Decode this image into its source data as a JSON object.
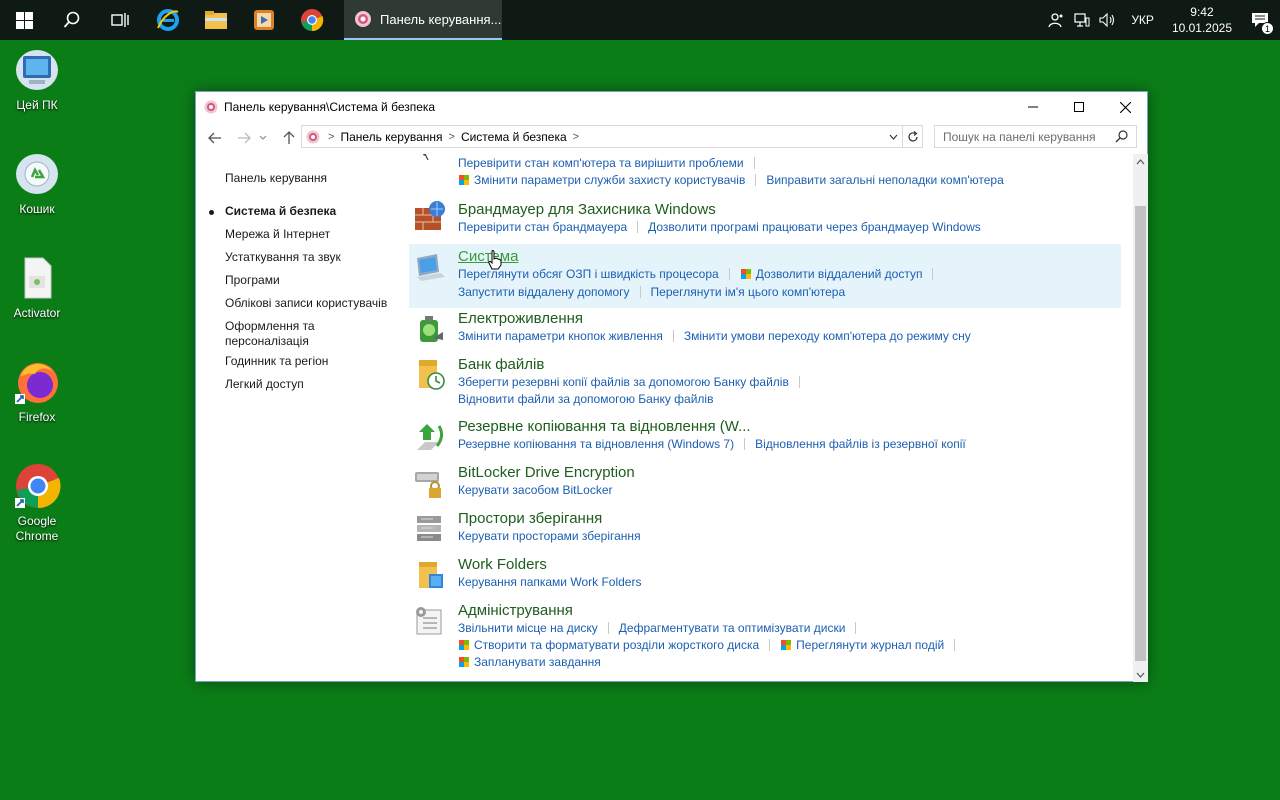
{
  "taskbar": {
    "active_task": "Панель керування...",
    "tray_lang": "УКР",
    "clock_time": "9:42",
    "clock_date": "10.01.2025",
    "notifications_count": "1"
  },
  "desktop": {
    "icons": [
      {
        "label": "Цей ПК"
      },
      {
        "label": "Кошик"
      },
      {
        "label": "Activator"
      },
      {
        "label": "Firefox"
      },
      {
        "label": "Google Chrome"
      }
    ]
  },
  "window": {
    "title": "Панель керування\\Система й безпека",
    "breadcrumb": [
      "Панель керування",
      "Система й безпека"
    ],
    "search_placeholder": "Пошук на панелі керування"
  },
  "leftnav": {
    "home": "Панель керування",
    "items": [
      "Система й безпека",
      "Мережа й Інтернет",
      "Устаткування та звук",
      "Програми",
      "Облікові записи користувачів",
      "Оформлення та",
      "персоналізація",
      "Годинник та регіон",
      "Легкий доступ"
    ]
  },
  "categories": {
    "security": {
      "links_row1": [
        "Перевірити стан комп'ютера та вирішити проблеми"
      ],
      "links_row2": [
        "Змінити параметри служби захисту користувачів",
        "Виправити загальні неполадки комп'ютера"
      ]
    },
    "firewall": {
      "title": "Брандмауер для Захисника Windows",
      "links": [
        "Перевірити стан брандмауера",
        "Дозволити програмі працювати через брандмауер Windows"
      ]
    },
    "system": {
      "title": "Система",
      "links_row1": [
        "Переглянути обсяг ОЗП і швидкість процесора",
        "Дозволити віддалений доступ"
      ],
      "links_row2": [
        "Запустити віддалену допомогу",
        "Переглянути ім'я цього комп'ютера"
      ]
    },
    "power": {
      "title": "Електроживлення",
      "links": [
        "Змінити параметри кнопок живлення",
        "Змінити умови переходу комп'ютера до режиму сну"
      ]
    },
    "filehistory": {
      "title": "Банк файлів",
      "links_row1": [
        "Зберегти резервні копії файлів за допомогою Банку файлів"
      ],
      "links_row2": [
        "Відновити файли за допомогою Банку файлів"
      ]
    },
    "backup": {
      "title": "Резервне копіювання та відновлення (W...",
      "links": [
        "Резервне копіювання та відновлення (Windows 7)",
        "Відновлення файлів із резервної копії"
      ]
    },
    "bitlocker": {
      "title": "BitLocker Drive Encryption",
      "links": [
        "Керувати засобом BitLocker"
      ]
    },
    "storage": {
      "title": "Простори зберігання",
      "links": [
        "Керувати просторами зберігання"
      ]
    },
    "workfolders": {
      "title": "Work Folders",
      "links": [
        "Керування папками Work Folders"
      ]
    },
    "admin": {
      "title": "Адміністрування",
      "links_row1": [
        "Звільнити місце на диску",
        "Дефрагментувати та оптимізувати диски"
      ],
      "links_row2": [
        "Створити та форматувати розділи жорсткого диска",
        "Переглянути журнал подій"
      ],
      "links_row3": [
        "Запланувати завдання"
      ]
    }
  },
  "colors": {
    "desktop_bg": "#0b7d17",
    "link": "#1c5fb1",
    "category_title": "#1e5d1e",
    "hover_bg": "#e5f3fb"
  }
}
